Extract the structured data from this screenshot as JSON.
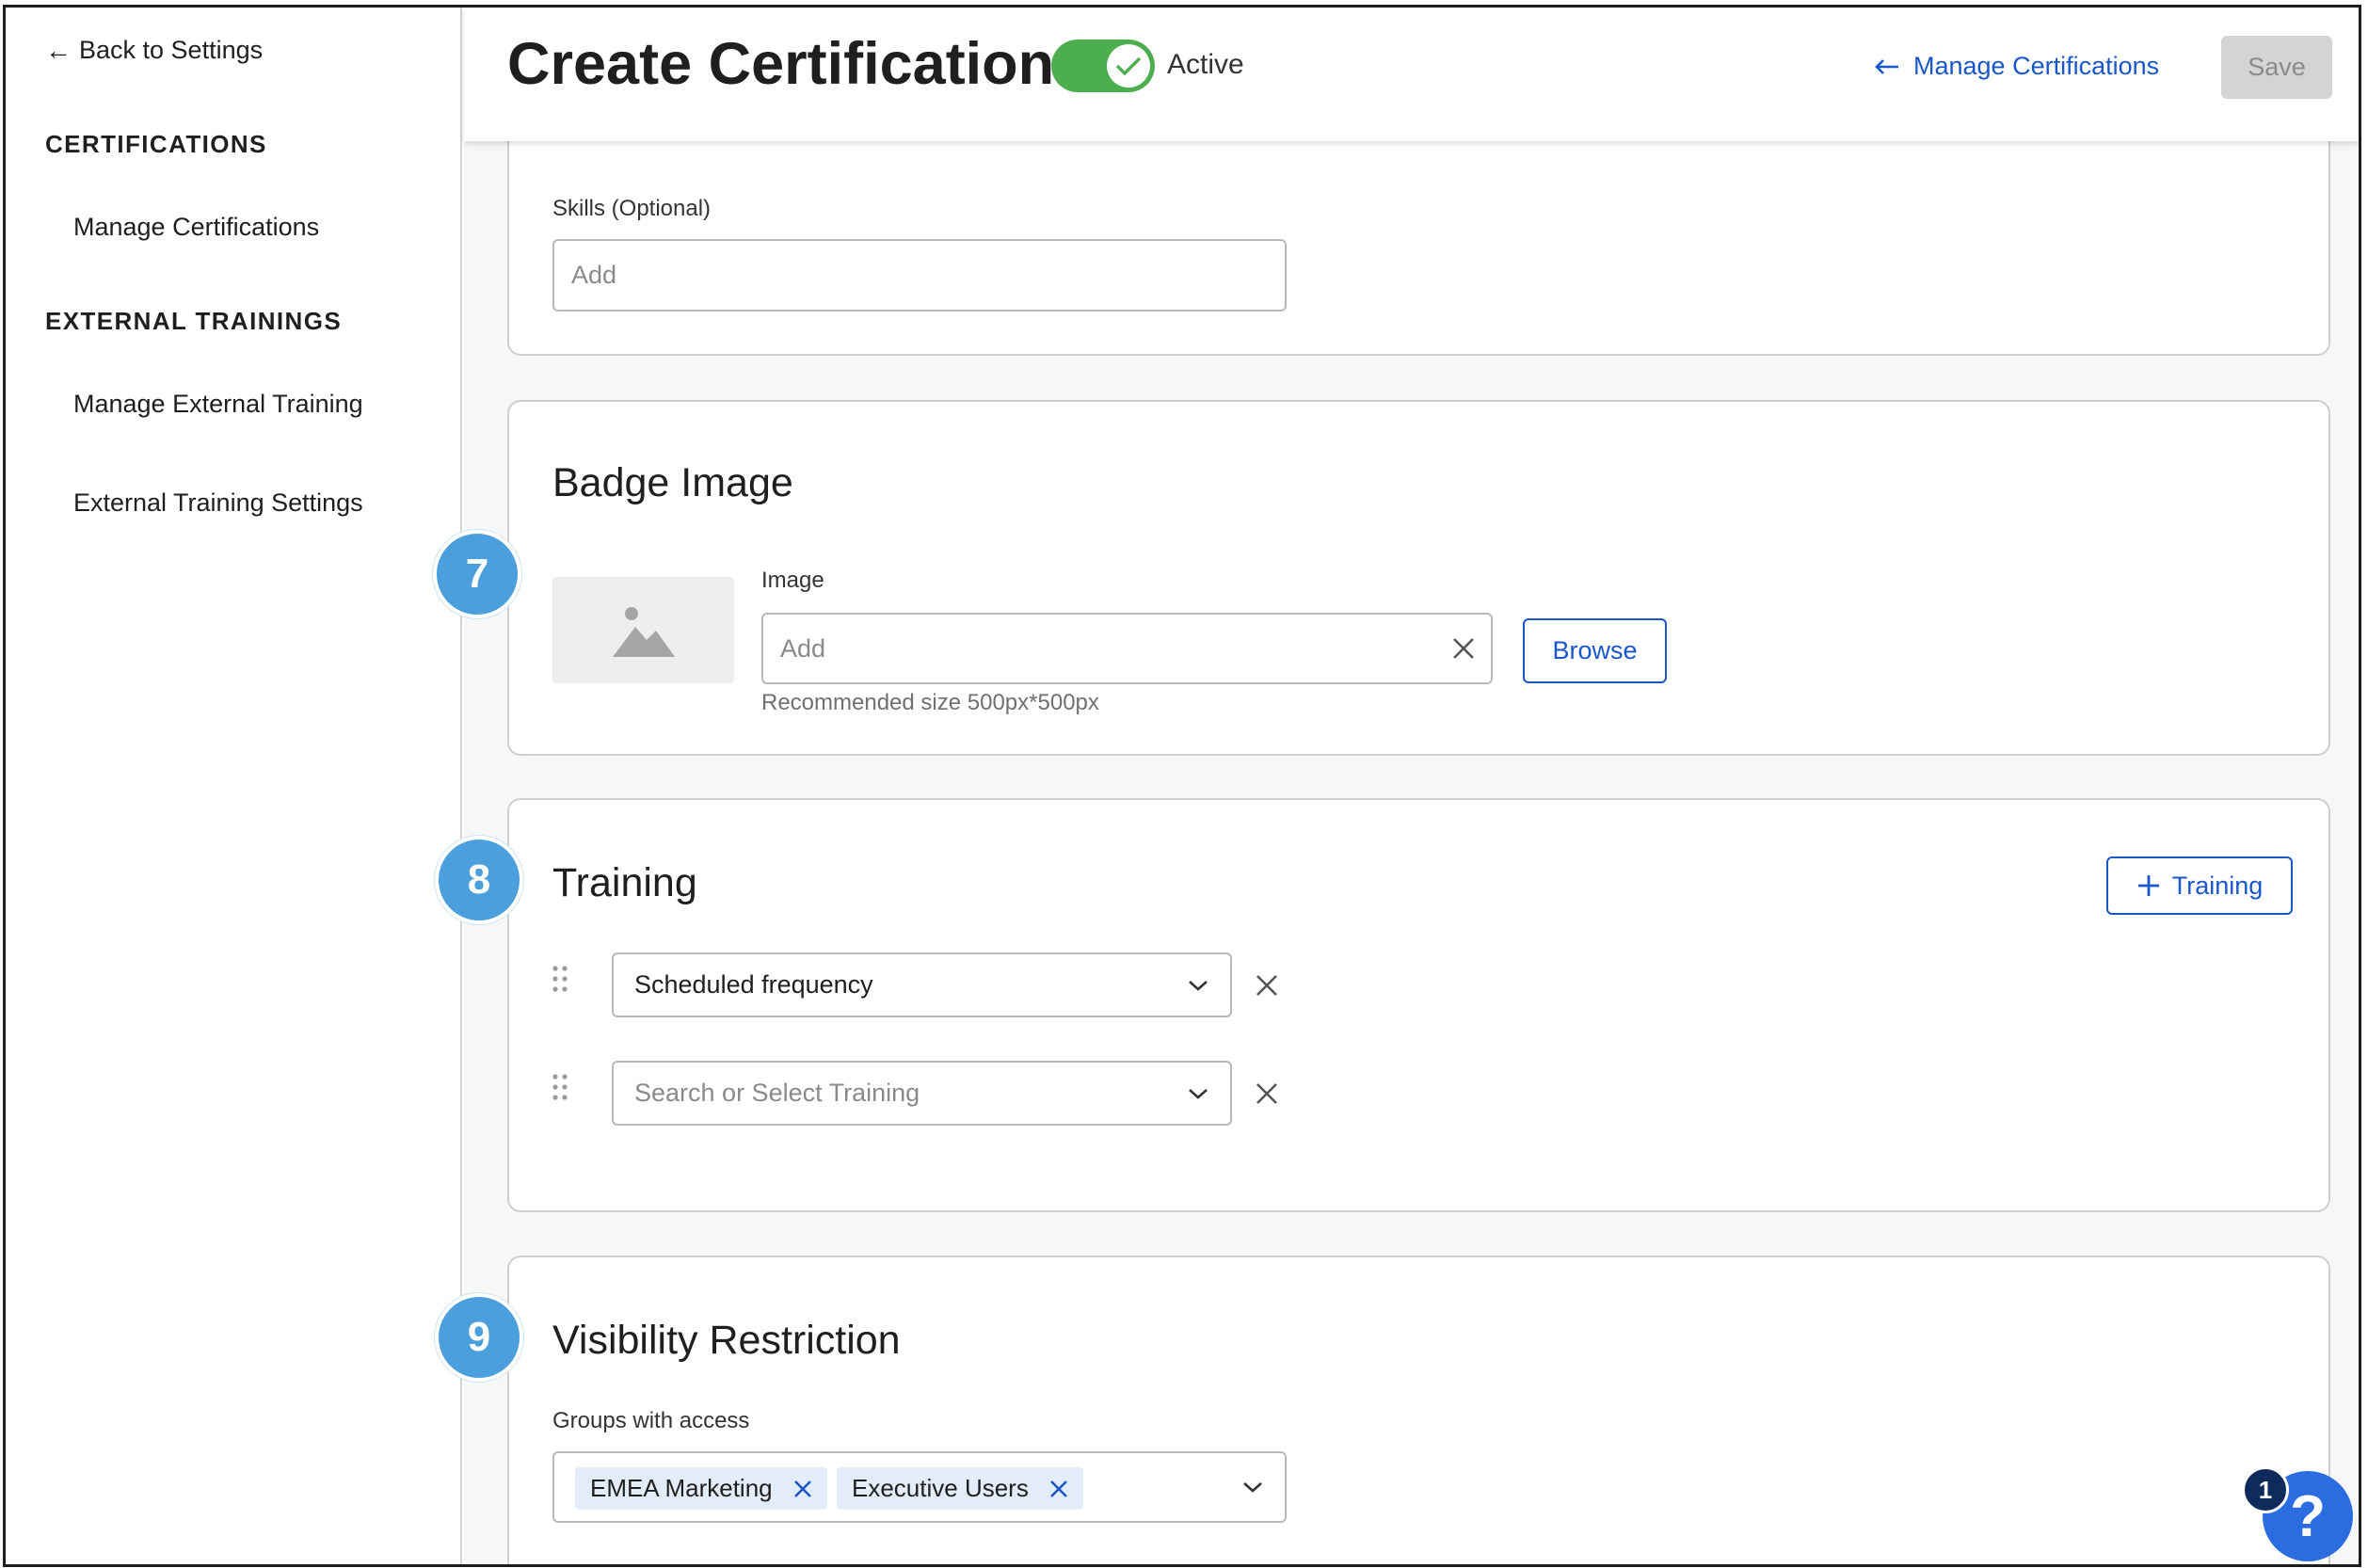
{
  "sidebar": {
    "back_label": "Back to Settings",
    "sections": [
      {
        "heading": "CERTIFICATIONS",
        "items": [
          "Manage Certifications"
        ]
      },
      {
        "heading": "EXTERNAL TRAININGS",
        "items": [
          "Manage External Training",
          "External Training Settings"
        ]
      }
    ]
  },
  "header": {
    "title": "Create Certification",
    "status_label": "Active",
    "manage_link": "Manage Certifications",
    "save_label": "Save"
  },
  "skills": {
    "label": "Skills (Optional)",
    "placeholder": "Add"
  },
  "badge": {
    "title": "Badge Image",
    "step": "7",
    "image_label": "Image",
    "image_placeholder": "Add",
    "browse_label": "Browse",
    "helper": "Recommended size 500px*500px"
  },
  "training": {
    "title": "Training",
    "step": "8",
    "add_label": "Training",
    "rows": [
      {
        "value": "Scheduled frequency"
      },
      {
        "placeholder": "Search or Select Training"
      }
    ]
  },
  "visibility": {
    "title": "Visibility Restriction",
    "step": "9",
    "groups_label": "Groups with access",
    "chips": [
      "EMEA Marketing",
      "Executive Users"
    ]
  },
  "help": {
    "count": "1",
    "glyph": "?"
  },
  "colors": {
    "accent": "#1a57c9",
    "toggle_on": "#4cae4f",
    "step_badge": "#4a9fdc",
    "chip_bg": "#e3ecf9"
  }
}
